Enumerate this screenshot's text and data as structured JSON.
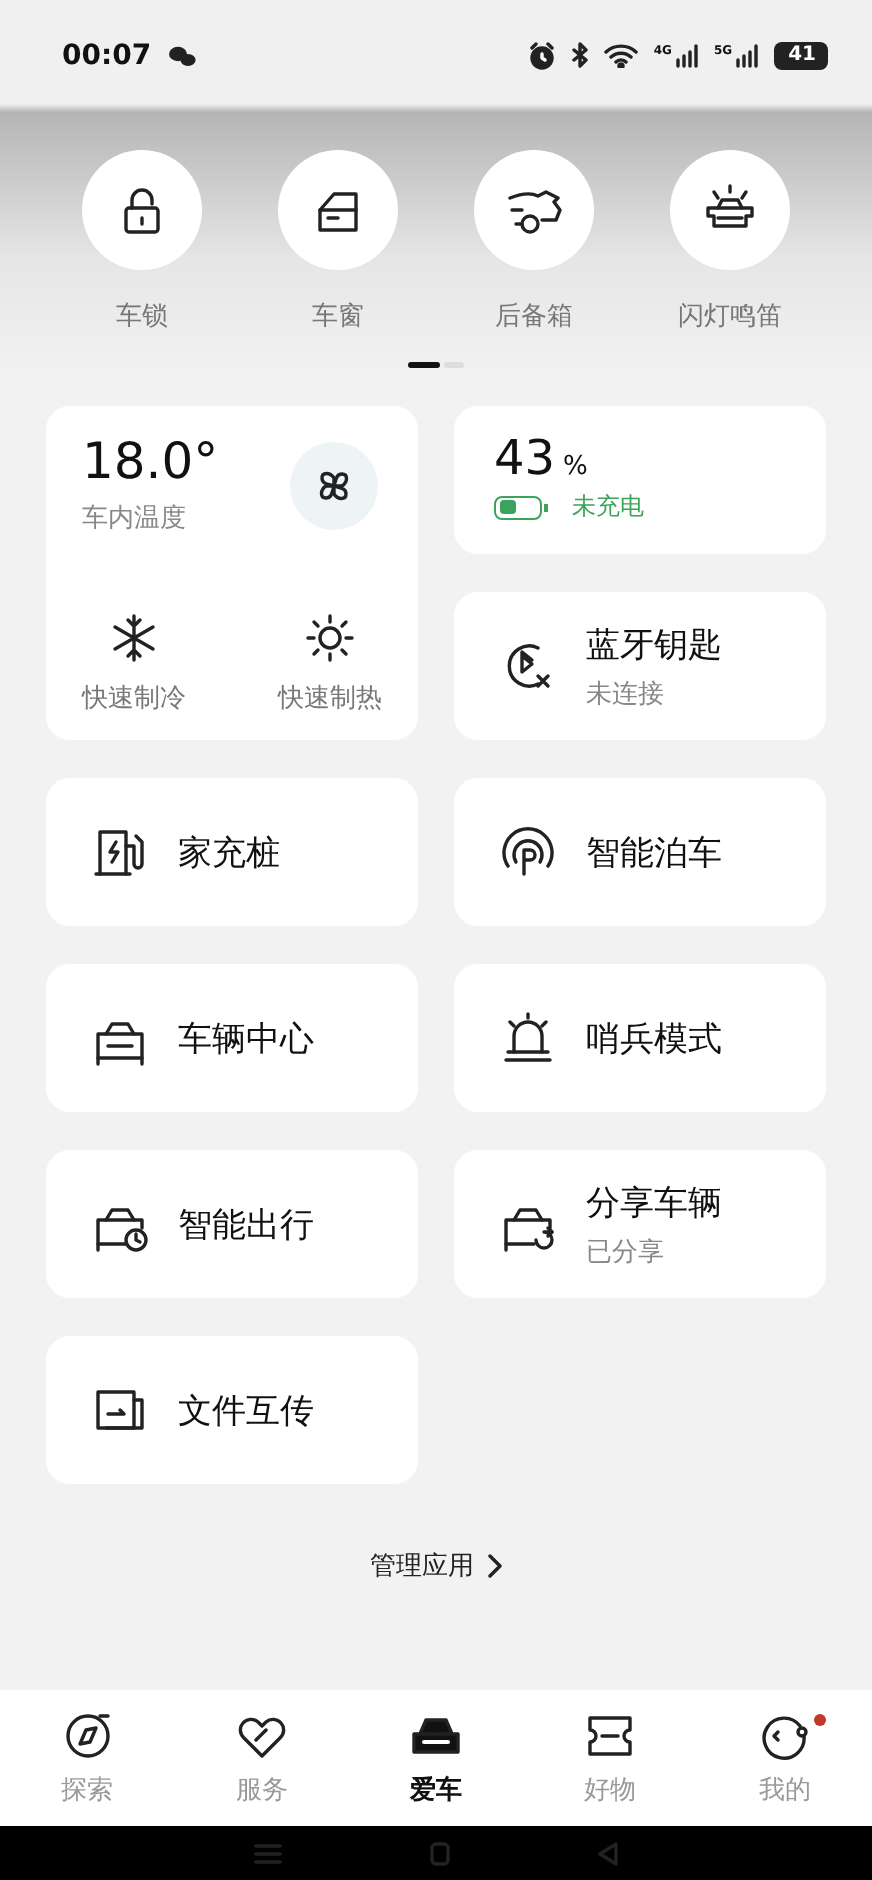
{
  "status_bar": {
    "time": "00:07",
    "signals": [
      "4G",
      "5G"
    ],
    "battery": "41"
  },
  "quick_actions": [
    {
      "label": "车锁"
    },
    {
      "label": "车窗"
    },
    {
      "label": "后备箱"
    },
    {
      "label": "闪灯鸣笛"
    }
  ],
  "pager": [
    {
      "selected": true
    },
    {
      "selected": false
    }
  ],
  "cards": [
    {
      "kind": "climate",
      "temperature": "18.0°",
      "label": "车内温度",
      "actions": [
        {
          "label": "快速制冷"
        },
        {
          "label": "快速制热"
        }
      ]
    },
    {
      "kind": "battery",
      "percent": "43",
      "unit": "%",
      "charging_status": "未充电"
    },
    {
      "kind": "app",
      "title": "蓝牙钥匙",
      "subtitle": "未连接"
    },
    {
      "kind": "app",
      "title": "家充桩"
    },
    {
      "kind": "app",
      "title": "智能泊车"
    },
    {
      "kind": "app",
      "title": "车辆中心"
    },
    {
      "kind": "app",
      "title": "哨兵模式"
    },
    {
      "kind": "app",
      "title": "智能出行"
    },
    {
      "kind": "app",
      "title": "分享车辆",
      "subtitle": "已分享"
    },
    {
      "kind": "app",
      "title": "文件互传"
    }
  ],
  "manage_apps": {
    "label": "管理应用"
  },
  "tabs": [
    {
      "label": "探索",
      "selected": false,
      "badge": false
    },
    {
      "label": "服务",
      "selected": false,
      "badge": false
    },
    {
      "label": "爱车",
      "selected": true,
      "badge": false
    },
    {
      "label": "好物",
      "selected": false,
      "badge": false
    },
    {
      "label": "我的",
      "selected": false,
      "badge": true
    }
  ]
}
